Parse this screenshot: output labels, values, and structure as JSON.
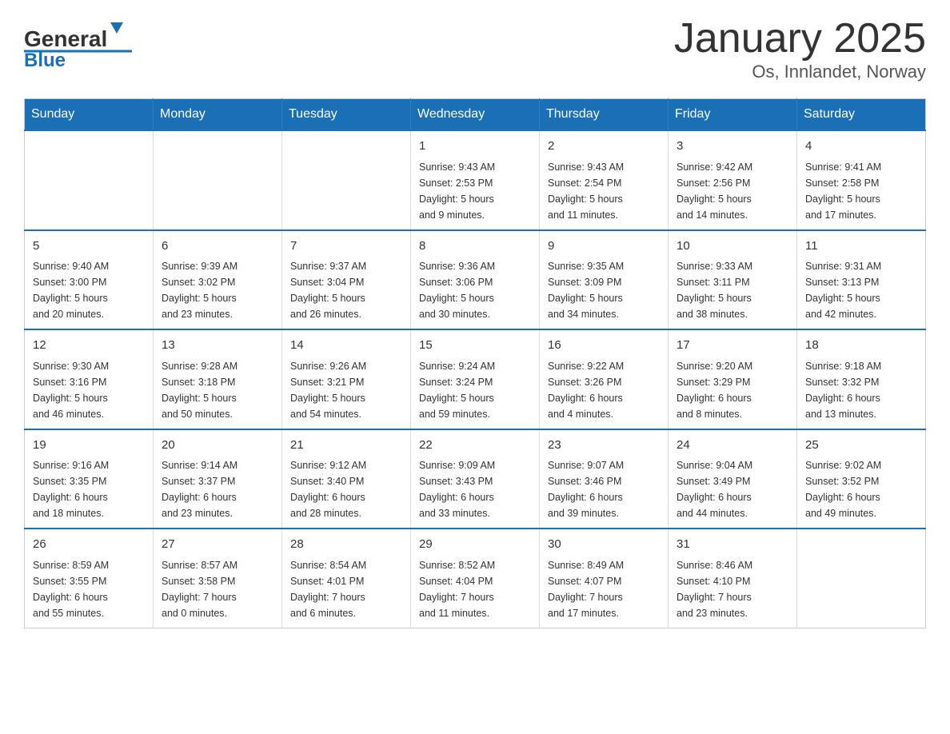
{
  "logo": {
    "general": "General",
    "blue": "Blue",
    "arrow_color": "#1a6fb5"
  },
  "title": "January 2025",
  "subtitle": "Os, Innlandet, Norway",
  "weekdays": [
    "Sunday",
    "Monday",
    "Tuesday",
    "Wednesday",
    "Thursday",
    "Friday",
    "Saturday"
  ],
  "weeks": [
    [
      {
        "day": "",
        "info": ""
      },
      {
        "day": "",
        "info": ""
      },
      {
        "day": "",
        "info": ""
      },
      {
        "day": "1",
        "info": "Sunrise: 9:43 AM\nSunset: 2:53 PM\nDaylight: 5 hours\nand 9 minutes."
      },
      {
        "day": "2",
        "info": "Sunrise: 9:43 AM\nSunset: 2:54 PM\nDaylight: 5 hours\nand 11 minutes."
      },
      {
        "day": "3",
        "info": "Sunrise: 9:42 AM\nSunset: 2:56 PM\nDaylight: 5 hours\nand 14 minutes."
      },
      {
        "day": "4",
        "info": "Sunrise: 9:41 AM\nSunset: 2:58 PM\nDaylight: 5 hours\nand 17 minutes."
      }
    ],
    [
      {
        "day": "5",
        "info": "Sunrise: 9:40 AM\nSunset: 3:00 PM\nDaylight: 5 hours\nand 20 minutes."
      },
      {
        "day": "6",
        "info": "Sunrise: 9:39 AM\nSunset: 3:02 PM\nDaylight: 5 hours\nand 23 minutes."
      },
      {
        "day": "7",
        "info": "Sunrise: 9:37 AM\nSunset: 3:04 PM\nDaylight: 5 hours\nand 26 minutes."
      },
      {
        "day": "8",
        "info": "Sunrise: 9:36 AM\nSunset: 3:06 PM\nDaylight: 5 hours\nand 30 minutes."
      },
      {
        "day": "9",
        "info": "Sunrise: 9:35 AM\nSunset: 3:09 PM\nDaylight: 5 hours\nand 34 minutes."
      },
      {
        "day": "10",
        "info": "Sunrise: 9:33 AM\nSunset: 3:11 PM\nDaylight: 5 hours\nand 38 minutes."
      },
      {
        "day": "11",
        "info": "Sunrise: 9:31 AM\nSunset: 3:13 PM\nDaylight: 5 hours\nand 42 minutes."
      }
    ],
    [
      {
        "day": "12",
        "info": "Sunrise: 9:30 AM\nSunset: 3:16 PM\nDaylight: 5 hours\nand 46 minutes."
      },
      {
        "day": "13",
        "info": "Sunrise: 9:28 AM\nSunset: 3:18 PM\nDaylight: 5 hours\nand 50 minutes."
      },
      {
        "day": "14",
        "info": "Sunrise: 9:26 AM\nSunset: 3:21 PM\nDaylight: 5 hours\nand 54 minutes."
      },
      {
        "day": "15",
        "info": "Sunrise: 9:24 AM\nSunset: 3:24 PM\nDaylight: 5 hours\nand 59 minutes."
      },
      {
        "day": "16",
        "info": "Sunrise: 9:22 AM\nSunset: 3:26 PM\nDaylight: 6 hours\nand 4 minutes."
      },
      {
        "day": "17",
        "info": "Sunrise: 9:20 AM\nSunset: 3:29 PM\nDaylight: 6 hours\nand 8 minutes."
      },
      {
        "day": "18",
        "info": "Sunrise: 9:18 AM\nSunset: 3:32 PM\nDaylight: 6 hours\nand 13 minutes."
      }
    ],
    [
      {
        "day": "19",
        "info": "Sunrise: 9:16 AM\nSunset: 3:35 PM\nDaylight: 6 hours\nand 18 minutes."
      },
      {
        "day": "20",
        "info": "Sunrise: 9:14 AM\nSunset: 3:37 PM\nDaylight: 6 hours\nand 23 minutes."
      },
      {
        "day": "21",
        "info": "Sunrise: 9:12 AM\nSunset: 3:40 PM\nDaylight: 6 hours\nand 28 minutes."
      },
      {
        "day": "22",
        "info": "Sunrise: 9:09 AM\nSunset: 3:43 PM\nDaylight: 6 hours\nand 33 minutes."
      },
      {
        "day": "23",
        "info": "Sunrise: 9:07 AM\nSunset: 3:46 PM\nDaylight: 6 hours\nand 39 minutes."
      },
      {
        "day": "24",
        "info": "Sunrise: 9:04 AM\nSunset: 3:49 PM\nDaylight: 6 hours\nand 44 minutes."
      },
      {
        "day": "25",
        "info": "Sunrise: 9:02 AM\nSunset: 3:52 PM\nDaylight: 6 hours\nand 49 minutes."
      }
    ],
    [
      {
        "day": "26",
        "info": "Sunrise: 8:59 AM\nSunset: 3:55 PM\nDaylight: 6 hours\nand 55 minutes."
      },
      {
        "day": "27",
        "info": "Sunrise: 8:57 AM\nSunset: 3:58 PM\nDaylight: 7 hours\nand 0 minutes."
      },
      {
        "day": "28",
        "info": "Sunrise: 8:54 AM\nSunset: 4:01 PM\nDaylight: 7 hours\nand 6 minutes."
      },
      {
        "day": "29",
        "info": "Sunrise: 8:52 AM\nSunset: 4:04 PM\nDaylight: 7 hours\nand 11 minutes."
      },
      {
        "day": "30",
        "info": "Sunrise: 8:49 AM\nSunset: 4:07 PM\nDaylight: 7 hours\nand 17 minutes."
      },
      {
        "day": "31",
        "info": "Sunrise: 8:46 AM\nSunset: 4:10 PM\nDaylight: 7 hours\nand 23 minutes."
      },
      {
        "day": "",
        "info": ""
      }
    ]
  ],
  "colors": {
    "header_bg": "#1a6fb5",
    "header_text": "#ffffff",
    "border": "#1a6fb5",
    "accent": "#1a6fb5"
  }
}
